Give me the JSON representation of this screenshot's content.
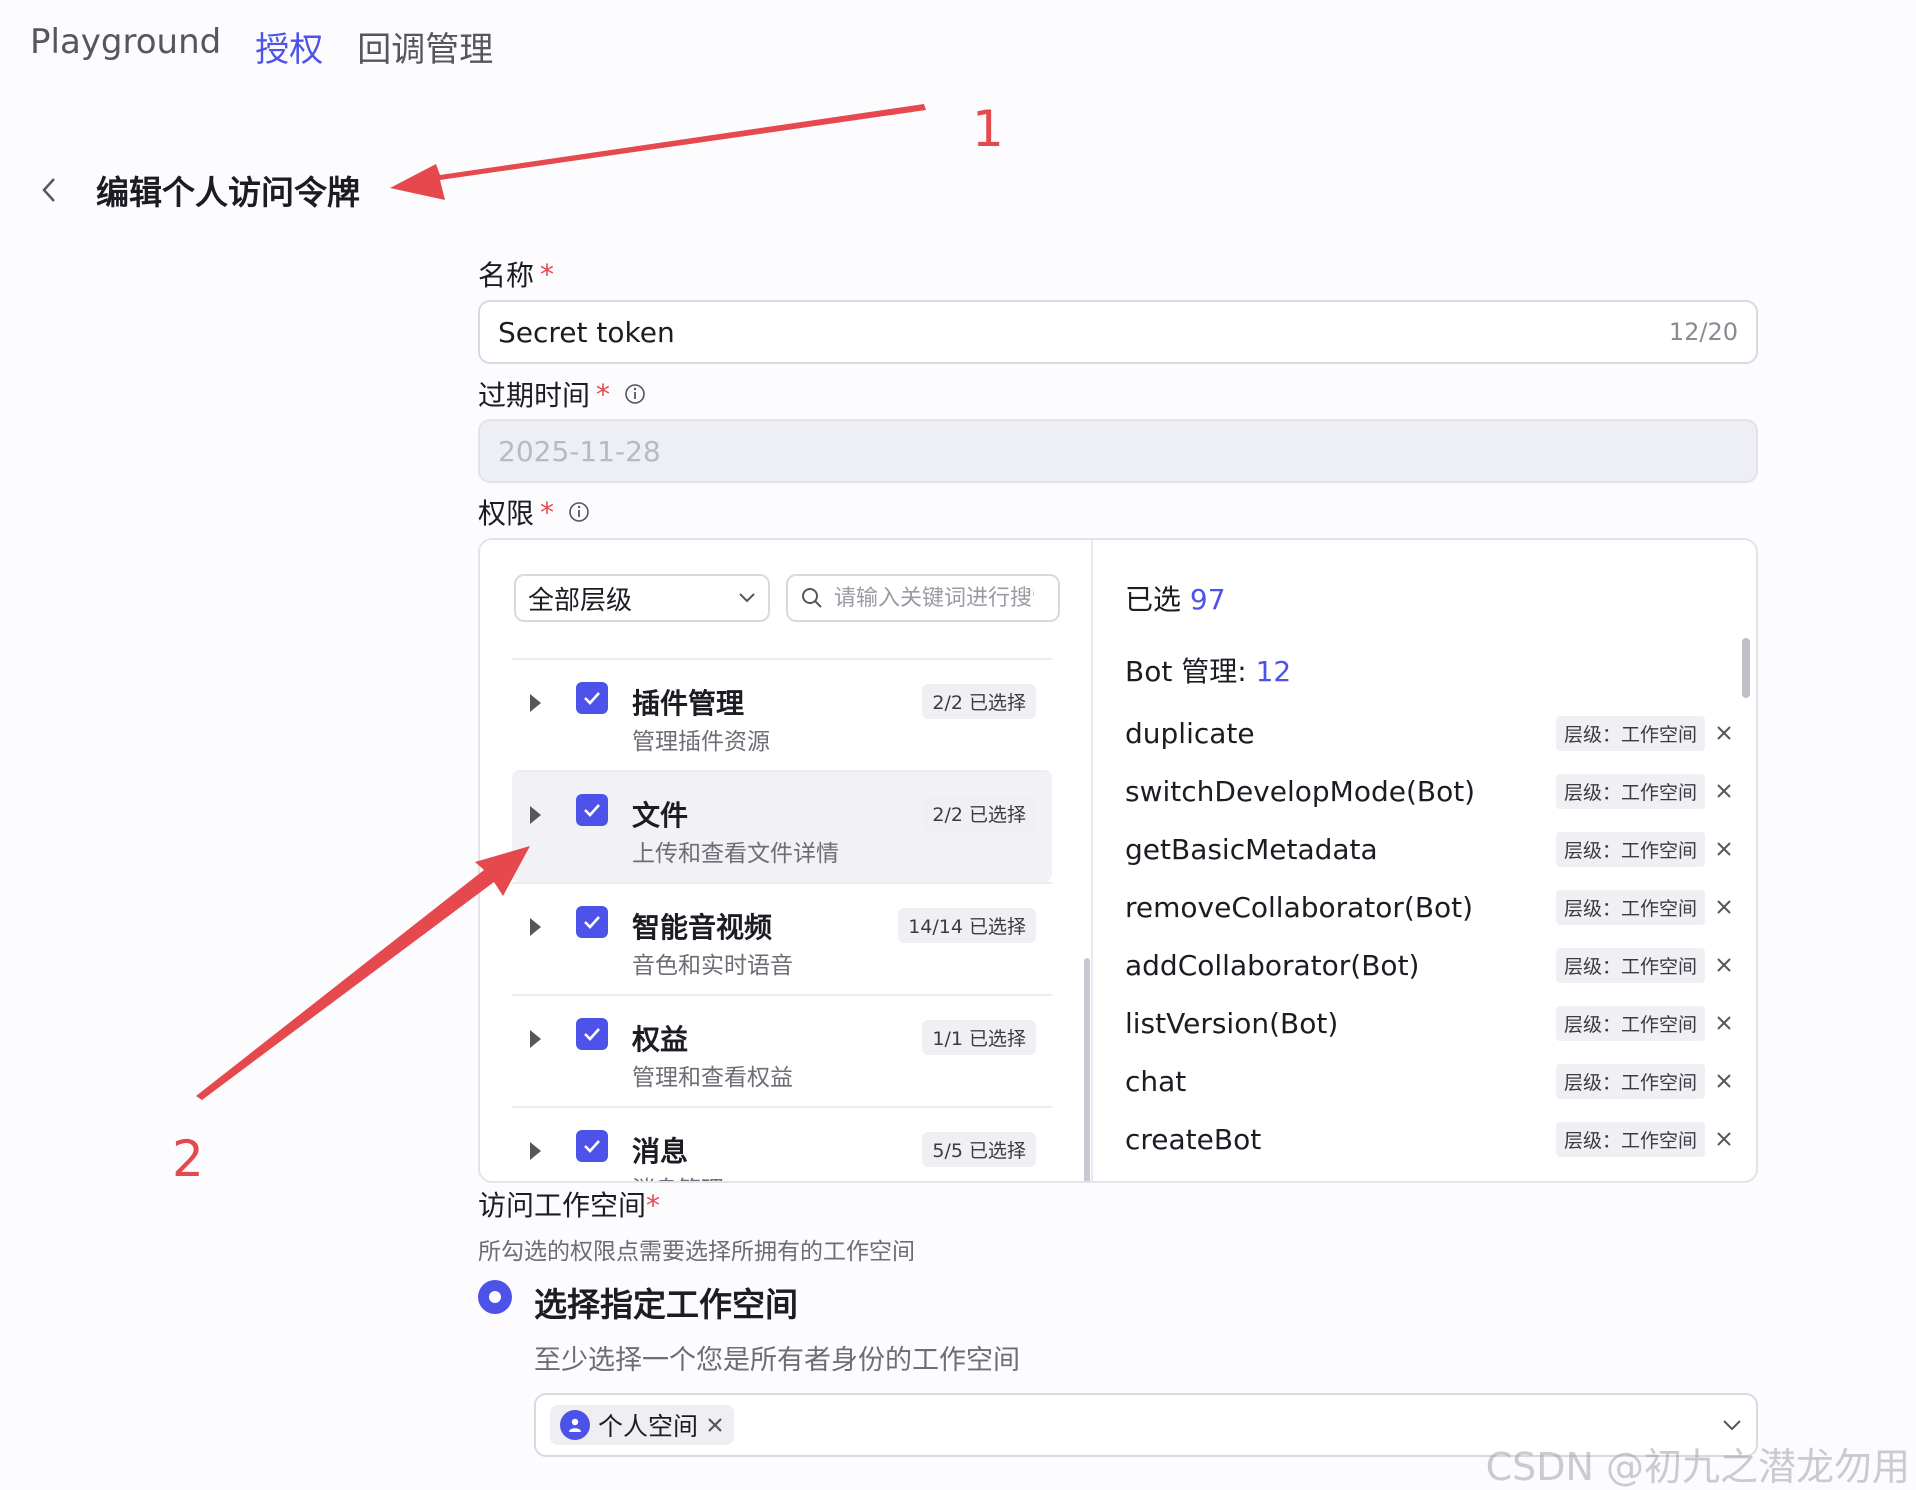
{
  "nav": {
    "items": [
      {
        "label": "Playground",
        "active": false
      },
      {
        "label": "授权",
        "active": true
      },
      {
        "label": "回调管理",
        "active": false
      }
    ]
  },
  "page": {
    "title": "编辑个人访问令牌"
  },
  "form": {
    "name": {
      "label": "名称",
      "required_mark": "*",
      "value": "Secret token",
      "counter": "12/20"
    },
    "expiry": {
      "label": "过期时间",
      "required_mark": "*",
      "value": "2025-11-28"
    },
    "permissions": {
      "label": "权限",
      "required_mark": "*",
      "level_select": "全部层级",
      "search_placeholder": "请输入关键词进行搜索",
      "items": [
        {
          "title": "插件管理",
          "desc": "管理插件资源",
          "badge": "2/2 已选择"
        },
        {
          "title": "文件",
          "desc": "上传和查看文件详情",
          "badge": "2/2 已选择"
        },
        {
          "title": "智能音视频",
          "desc": "音色和实时语音",
          "badge": "14/14 已选择"
        },
        {
          "title": "权益",
          "desc": "管理和查看权益",
          "badge": "1/1 已选择"
        },
        {
          "title": "消息",
          "desc": "消息管理",
          "badge": "5/5 已选择"
        }
      ],
      "selected_label": "已选",
      "selected_count": "97",
      "group_label": "Bot 管理:",
      "group_count": "12",
      "level_tag": "层级：工作空间",
      "selected_items": [
        "duplicate",
        "switchDevelopMode(Bot)",
        "getBasicMetadata",
        "removeCollaborator(Bot)",
        "addCollaborator(Bot)",
        "listVersion(Bot)",
        "chat",
        "createBot"
      ]
    },
    "workspace": {
      "label": "访问工作空间",
      "required_mark": "*",
      "help": "所勾选的权限点需要选择所拥有的工作空间",
      "option_label": "选择指定工作空间",
      "option_help": "至少选择一个您是所有者身份的工作空间",
      "chip": "个人空间"
    }
  },
  "annotations": {
    "one": "1",
    "two": "2"
  },
  "watermark": "CSDN @初九之潜龙勿用",
  "colors": {
    "accent": "#4d53e8",
    "annotation": "#e5484d"
  }
}
